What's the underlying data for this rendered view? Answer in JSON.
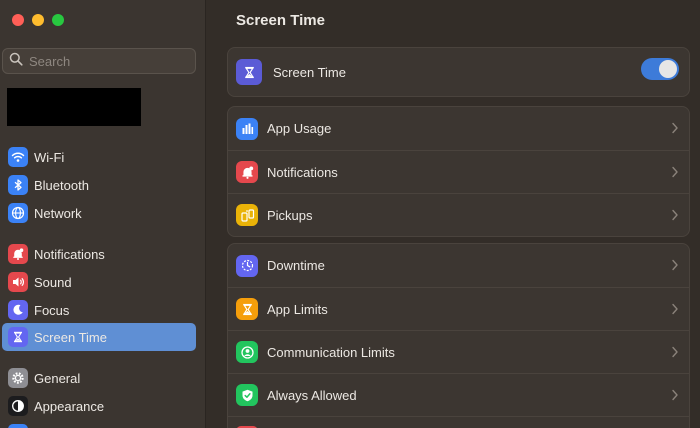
{
  "window": {
    "controls": [
      "close",
      "minimize",
      "maximize"
    ]
  },
  "sidebar": {
    "search": {
      "placeholder": "Search",
      "value": ""
    },
    "items": [
      {
        "id": "wifi",
        "label": "Wi-Fi",
        "icon": "wifi-icon",
        "color": "#3b82f6",
        "active": false
      },
      {
        "id": "bluetooth",
        "label": "Bluetooth",
        "icon": "bluetooth-icon",
        "color": "#3b82f6",
        "active": false
      },
      {
        "id": "network",
        "label": "Network",
        "icon": "globe-icon",
        "color": "#3b82f6",
        "active": false
      },
      {
        "id": "notifications",
        "label": "Notifications",
        "icon": "bell-icon",
        "color": "#e5484d",
        "active": false
      },
      {
        "id": "sound",
        "label": "Sound",
        "icon": "speaker-icon",
        "color": "#e5484d",
        "active": false
      },
      {
        "id": "focus",
        "label": "Focus",
        "icon": "moon-icon",
        "color": "#6366f1",
        "active": false
      },
      {
        "id": "screen-time",
        "label": "Screen Time",
        "icon": "hourglass-icon",
        "color": "#6366f1",
        "active": true
      },
      {
        "id": "general",
        "label": "General",
        "icon": "gear-icon",
        "color": "#8e8e93",
        "active": false
      },
      {
        "id": "appearance",
        "label": "Appearance",
        "icon": "appearance-icon",
        "color": "#1c1c1e",
        "active": false
      }
    ]
  },
  "main": {
    "title": "Screen Time",
    "master": {
      "label": "Screen Time",
      "icon": "hourglass-icon",
      "color": "#5b5bd6",
      "enabled": true
    },
    "usage_group": [
      {
        "label": "App Usage",
        "icon": "bar-chart-icon",
        "color": "#3b82f6"
      },
      {
        "label": "Notifications",
        "icon": "bell-icon",
        "color": "#e5484d"
      },
      {
        "label": "Pickups",
        "icon": "pickup-icon",
        "color": "#eab308"
      }
    ],
    "limits_group": [
      {
        "label": "Downtime",
        "icon": "downtime-icon",
        "color": "#6366f1"
      },
      {
        "label": "App Limits",
        "icon": "hourglass-icon",
        "color": "#f59e0b"
      },
      {
        "label": "Communication Limits",
        "icon": "person-circle-icon",
        "color": "#22c55e"
      },
      {
        "label": "Always Allowed",
        "icon": "check-shield-icon",
        "color": "#22c55e"
      }
    ]
  }
}
